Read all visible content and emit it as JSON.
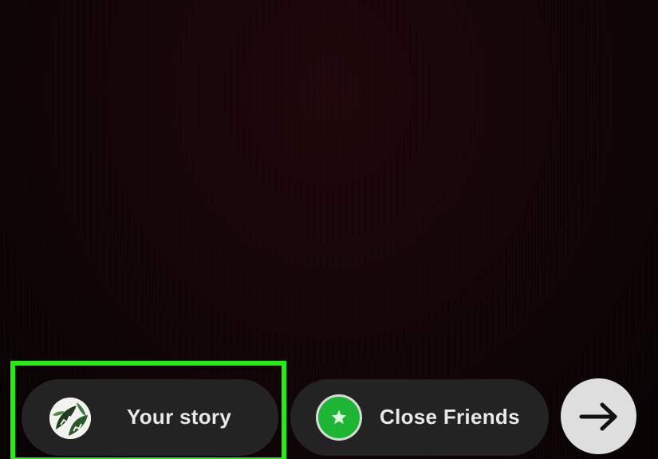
{
  "share_bar": {
    "your_story": {
      "label": "Your story",
      "avatar_icon": "monstera-leaf-avatar-icon"
    },
    "close_friends": {
      "label": "Close Friends",
      "icon": "star-icon",
      "icon_color": "#1db534"
    },
    "next": {
      "icon": "arrow-right-icon"
    },
    "highlight_color": "#22ee11"
  }
}
